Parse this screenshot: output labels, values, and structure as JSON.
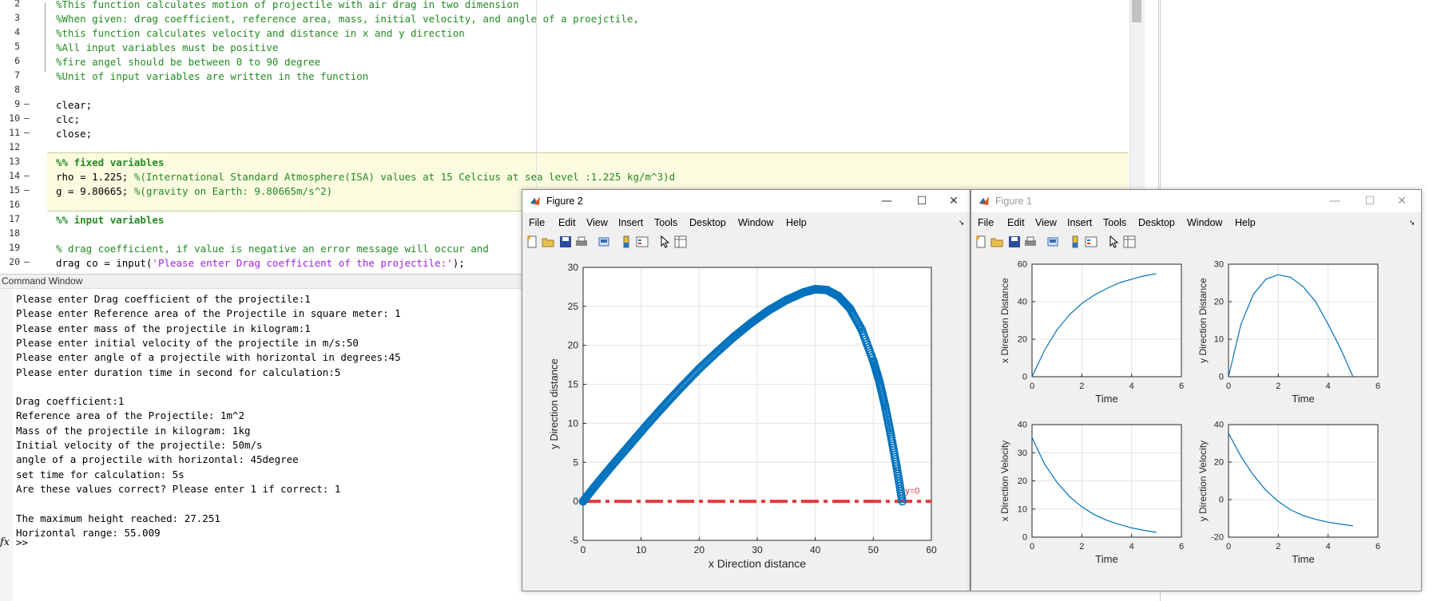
{
  "editor": {
    "lines": [
      {
        "num": "2",
        "dash": "",
        "parts": [
          {
            "t": "%This function calculates motion of projectile with air drag in two dimension",
            "c": "cmt"
          }
        ]
      },
      {
        "num": "3",
        "dash": "",
        "parts": [
          {
            "t": "%When given: drag coefficient, reference area, mass, initial velocity, and angle of a proejctile,",
            "c": "cmt"
          }
        ]
      },
      {
        "num": "4",
        "dash": "",
        "parts": [
          {
            "t": "%this function calculates velocity and distance in x and y direction",
            "c": "cmt"
          }
        ]
      },
      {
        "num": "5",
        "dash": "",
        "parts": [
          {
            "t": "%All input variables must be positive",
            "c": "cmt"
          }
        ]
      },
      {
        "num": "6",
        "dash": "",
        "parts": [
          {
            "t": "%fire angel should be between 0 to 90 degree",
            "c": "cmt"
          }
        ]
      },
      {
        "num": "7",
        "dash": "",
        "parts": [
          {
            "t": "%Unit of input variables are written in the function",
            "c": "cmt"
          }
        ]
      },
      {
        "num": "8",
        "dash": "",
        "parts": []
      },
      {
        "num": "9",
        "dash": "–",
        "parts": [
          {
            "t": "clear;",
            "c": ""
          }
        ]
      },
      {
        "num": "10",
        "dash": "–",
        "parts": [
          {
            "t": "clc;",
            "c": ""
          }
        ]
      },
      {
        "num": "11",
        "dash": "–",
        "parts": [
          {
            "t": "close;",
            "c": ""
          }
        ]
      },
      {
        "num": "12",
        "dash": "",
        "parts": []
      },
      {
        "num": "13",
        "dash": "",
        "parts": [
          {
            "t": "%% fixed variables",
            "c": "cell"
          }
        ]
      },
      {
        "num": "14",
        "dash": "–",
        "parts": [
          {
            "t": "rho = 1.225; ",
            "c": ""
          },
          {
            "t": "%(International Standard Atmosphere(ISA) values at 15 Celcius at sea level :1.225 kg/m^3)d",
            "c": "cmt"
          }
        ]
      },
      {
        "num": "15",
        "dash": "–",
        "parts": [
          {
            "t": "g = 9.80665; ",
            "c": ""
          },
          {
            "t": "%(gravity on Earth: 9.80665m/s^2)",
            "c": "cmt"
          }
        ]
      },
      {
        "num": "16",
        "dash": "",
        "parts": []
      },
      {
        "num": "17",
        "dash": "",
        "parts": [
          {
            "t": "%% input variables",
            "c": "cell"
          }
        ]
      },
      {
        "num": "18",
        "dash": "",
        "parts": []
      },
      {
        "num": "19",
        "dash": "",
        "parts": [
          {
            "t": "% drag coefficient, if value is negative an error message will occur and",
            "c": "cmt"
          }
        ]
      },
      {
        "num": "20",
        "dash": "–",
        "parts": [
          {
            "t": "drag co = input(",
            "c": ""
          },
          {
            "t": "'Please enter Drag coefficient of the projectile:'",
            "c": "str"
          },
          {
            "t": ");",
            "c": ""
          }
        ]
      }
    ]
  },
  "command_window": {
    "title": "Command Window",
    "lines": [
      "Please enter Drag coefficient of the projectile:1",
      "Please enter Reference area of the Projectile in square meter: 1",
      "Please enter mass of the projectile in kilogram:1",
      "Please enter initial velocity of the projectile in m/s:50",
      "Please enter angle of a projectile with horizontal in degrees:45",
      "Please enter duration time in second for calculation:5",
      "",
      "Drag coefficient:1",
      "Reference area of the Projectile: 1m^2",
      "Mass of the projectile in kilogram: 1kg",
      "Initial velocity of the projectile: 50m/s",
      "angle of a projectile with horizontal: 45degree",
      "set time for calculation: 5s",
      "Are these values correct? Please enter 1 if correct: 1",
      "",
      "The maximum height reached: 27.251",
      "Horizontal range: 55.009"
    ],
    "prompt_icon": "fx",
    "prompt": ">>"
  },
  "figure2": {
    "title": "Figure 2",
    "menu": [
      "File",
      "Edit",
      "View",
      "Insert",
      "Tools",
      "Desktop",
      "Window",
      "Help"
    ],
    "win_buttons": {
      "minimize": "—",
      "maximize": "☐",
      "close": "✕"
    }
  },
  "figure1": {
    "title": "Figure 1",
    "menu": [
      "File",
      "Edit",
      "View",
      "Insert",
      "Tools",
      "Desktop",
      "Window",
      "Help"
    ],
    "win_buttons": {
      "minimize": "—",
      "maximize": "☐",
      "close": "✕"
    }
  },
  "colors": {
    "series": "#0072bd",
    "ref_line": "#e8383d",
    "fig_bg": "#f0f0f0"
  },
  "chart_data": [
    {
      "type": "scatter",
      "xlabel": "x Direction distance",
      "ylabel": "y Direction distance",
      "xlim": [
        0,
        60
      ],
      "ylim": [
        -5,
        30
      ],
      "xticks": [
        0,
        10,
        20,
        30,
        40,
        50,
        60
      ],
      "yticks": [
        -5,
        0,
        5,
        10,
        15,
        20,
        25,
        30
      ],
      "grid": true,
      "series": [
        {
          "x": [
            0,
            2,
            5,
            8,
            11,
            14,
            17,
            20,
            23,
            26,
            29,
            32,
            35,
            38,
            40,
            42,
            44,
            46,
            48,
            50,
            51,
            52,
            53,
            54,
            55
          ],
          "y": [
            0,
            1.9,
            4.6,
            7.2,
            9.8,
            12.3,
            14.7,
            17,
            19.1,
            21.1,
            22.9,
            24.5,
            25.8,
            26.8,
            27.2,
            27.1,
            26.3,
            24.7,
            22,
            18,
            15.5,
            12.3,
            8.6,
            4.5,
            0
          ]
        }
      ],
      "annotations": [
        {
          "text": "y=0",
          "x": 55.5,
          "y": 1
        }
      ],
      "ref_line": {
        "y": 0
      }
    },
    {
      "type": "line",
      "xlabel": "Time",
      "ylabel": "x Direction Distance",
      "xlim": [
        0,
        6
      ],
      "ylim": [
        0,
        60
      ],
      "xticks": [
        0,
        2,
        4,
        6
      ],
      "yticks": [
        0,
        20,
        40,
        60
      ],
      "grid": true,
      "series": [
        {
          "x": [
            0,
            0.5,
            1,
            1.5,
            2,
            2.5,
            3,
            3.5,
            4,
            4.5,
            5
          ],
          "y": [
            0,
            14,
            25,
            33,
            39,
            43.5,
            47,
            50,
            52,
            53.8,
            55
          ]
        }
      ]
    },
    {
      "type": "line",
      "xlabel": "Time",
      "ylabel": "y Direction Distance",
      "xlim": [
        0,
        6
      ],
      "ylim": [
        0,
        30
      ],
      "xticks": [
        0,
        2,
        4,
        6
      ],
      "yticks": [
        0,
        10,
        20,
        30
      ],
      "grid": true,
      "series": [
        {
          "x": [
            0,
            0.5,
            1,
            1.5,
            2,
            2.5,
            3,
            3.5,
            4,
            4.5,
            5
          ],
          "y": [
            0,
            14,
            22,
            26,
            27.2,
            26.5,
            24,
            20,
            14,
            7.5,
            0
          ]
        }
      ]
    },
    {
      "type": "line",
      "xlabel": "Time",
      "ylabel": "x Direction Velocity",
      "xlim": [
        0,
        6
      ],
      "ylim": [
        0,
        40
      ],
      "xticks": [
        0,
        2,
        4,
        6
      ],
      "yticks": [
        0,
        10,
        20,
        30,
        40
      ],
      "grid": true,
      "series": [
        {
          "x": [
            0,
            0.5,
            1,
            1.5,
            2,
            2.5,
            3,
            3.5,
            4,
            4.5,
            5
          ],
          "y": [
            35.4,
            26,
            19.5,
            14.5,
            10.8,
            8,
            6,
            4.5,
            3.3,
            2.4,
            1.7
          ]
        }
      ]
    },
    {
      "type": "line",
      "xlabel": "Time",
      "ylabel": "y Direction Velocity",
      "xlim": [
        0,
        6
      ],
      "ylim": [
        -20,
        40
      ],
      "xticks": [
        0,
        2,
        4,
        6
      ],
      "yticks": [
        -20,
        0,
        20,
        40
      ],
      "grid": true,
      "series": [
        {
          "x": [
            0,
            0.5,
            1,
            1.5,
            2,
            2.5,
            3,
            3.5,
            4,
            4.5,
            5
          ],
          "y": [
            35.4,
            23,
            13,
            5,
            -1,
            -5.5,
            -8.5,
            -10.5,
            -12,
            -13,
            -14
          ]
        }
      ]
    }
  ]
}
